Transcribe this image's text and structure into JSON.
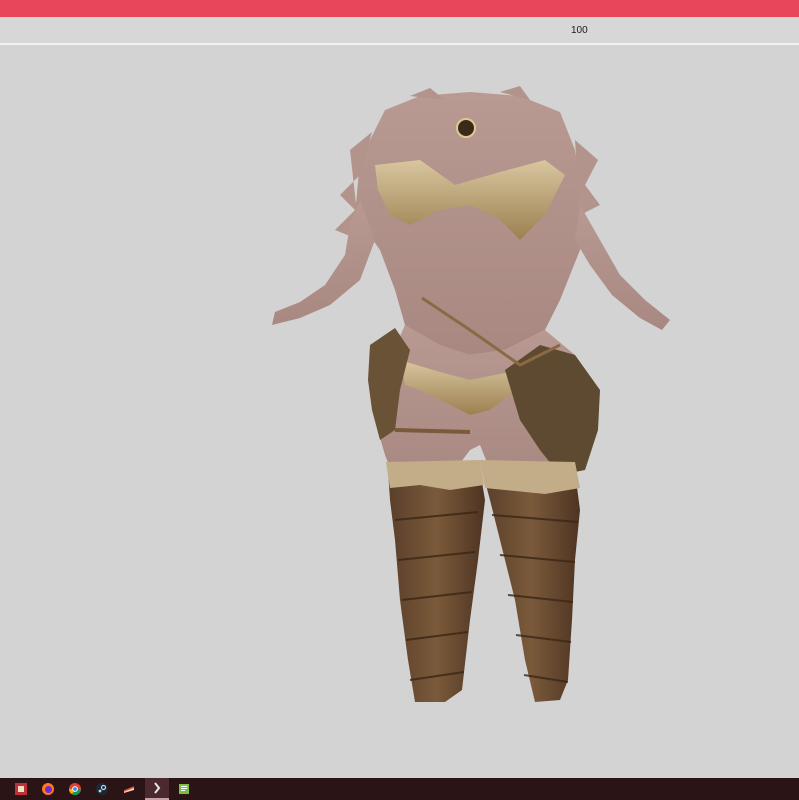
{
  "window": {
    "accent_color": "#e8465a"
  },
  "toolbar": {
    "slider_value": "100"
  },
  "viewport": {
    "content": "3d-model-preview",
    "background": "#d3d3d3"
  },
  "taskbar": {
    "background": "#2b1416",
    "items": [
      {
        "icon": "app-icon-red",
        "active": false
      },
      {
        "icon": "firefox-icon",
        "active": false
      },
      {
        "icon": "chrome-icon",
        "active": false
      },
      {
        "icon": "steam-icon",
        "active": false
      },
      {
        "icon": "cake-icon",
        "active": false
      },
      {
        "icon": "outfit-studio-icon",
        "active": true
      },
      {
        "icon": "notepad-icon",
        "active": false
      }
    ]
  }
}
